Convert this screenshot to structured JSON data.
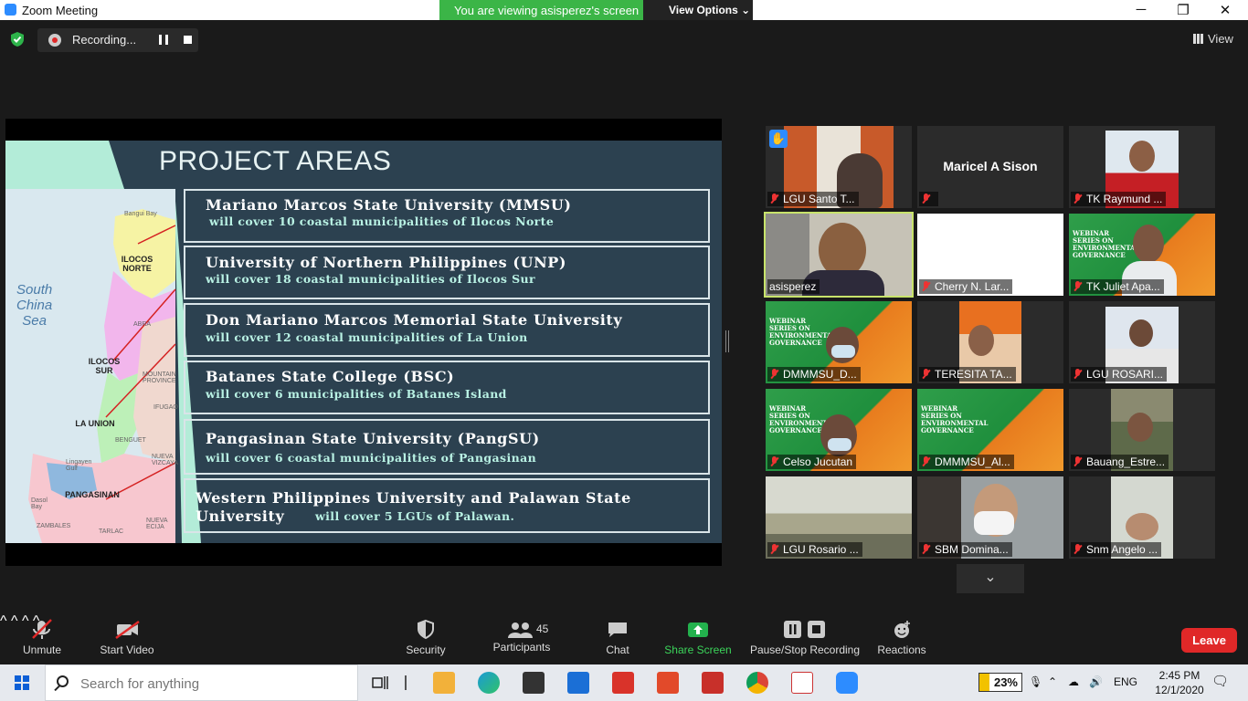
{
  "window": {
    "title": "Zoom Meeting",
    "share_banner": "You are viewing asisperez's screen",
    "view_options": "View Options",
    "controls": {
      "minimize": "─",
      "restore": "❐",
      "close": "✕"
    }
  },
  "recording": {
    "label": "Recording..."
  },
  "view_button": "View",
  "slide": {
    "title": "PROJECT AREAS",
    "universities": [
      {
        "name": "Mariano Marcos State University (MMSU)",
        "cover": "will cover  10 coastal municipalities of Ilocos Norte"
      },
      {
        "name": "University of Northern Philippines (UNP)",
        "cover": "will cover 18 coastal municipalities of Ilocos Sur"
      },
      {
        "name": "Don Mariano Marcos Memorial State University",
        "cover": "will cover  12 coastal municipalities of La Union"
      },
      {
        "name": "Batanes State College (BSC)",
        "cover": "will cover  6 municipalities   of Batanes Island"
      },
      {
        "name": "Pangasinan State University (PangSU)",
        "cover": "will cover  6  coastal municipalities of Pangasinan"
      },
      {
        "name": "Western Philippines University and Palawan State",
        "name2": "University",
        "cover": "will cover  5 LGUs of Palawan."
      }
    ],
    "map": {
      "sea": [
        "South",
        "China",
        "Sea"
      ],
      "provinces": [
        "ILOCOS NORTE",
        "ILOCOS SUR",
        "LA UNION",
        "PANGASINAN"
      ],
      "minor": [
        "Bangui Bay",
        "ABRA",
        "MOUNTAIN PROVINCE",
        "IFUGAO",
        "BENGUET",
        "NUEVA VIZCAYA",
        "Lingayen Gulf",
        "Dasol Bay",
        "ZAMBALES",
        "TARLAC",
        "NUEVA ECIJA"
      ]
    }
  },
  "participants_tiles": [
    {
      "name": "LGU Santo T...",
      "hand_raised": true,
      "muted": true
    },
    {
      "name": "",
      "big_name": "Maricel A Sison",
      "muted": true
    },
    {
      "name": "TK Raymund ...",
      "muted": true
    },
    {
      "name": "asisperez",
      "muted": false,
      "active_speaker": true
    },
    {
      "name": "Cherry N. Lar...",
      "muted": true
    },
    {
      "name": "TK Juliet Apa...",
      "muted": true
    },
    {
      "name": "DMMMSU_D...",
      "muted": true
    },
    {
      "name": "TERESITA TA...",
      "muted": true
    },
    {
      "name": "LGU ROSARI...",
      "muted": true
    },
    {
      "name": "Celso Jucutan",
      "muted": true
    },
    {
      "name": "DMMMSU_Al...",
      "muted": true
    },
    {
      "name": "Bauang_Estre...",
      "muted": true
    },
    {
      "name": "LGU Rosario ...",
      "muted": true
    },
    {
      "name": "SBM Domina...",
      "muted": true
    },
    {
      "name": "Snm Angelo ...",
      "muted": true
    }
  ],
  "webinar_text": "WEBINAR SERIES ON ENVIRONMENTAL GOVERNANCE",
  "toolbar": {
    "unmute": "Unmute",
    "start_video": "Start Video",
    "security": "Security",
    "participants": "Participants",
    "participants_count": "45",
    "chat": "Chat",
    "share_screen": "Share Screen",
    "pause_stop_recording": "Pause/Stop Recording",
    "reactions": "Reactions",
    "leave": "Leave"
  },
  "taskbar": {
    "search_placeholder": "Search for anything",
    "battery": "23%",
    "language": "ENG",
    "time": "2:45 PM",
    "date": "12/1/2020"
  },
  "colors": {
    "accent_blue": "#2d8cff",
    "share_green": "#3bb547",
    "leave_red": "#e02828",
    "active_speaker": "#c8e36b",
    "slide_bg": "#2c4150"
  }
}
